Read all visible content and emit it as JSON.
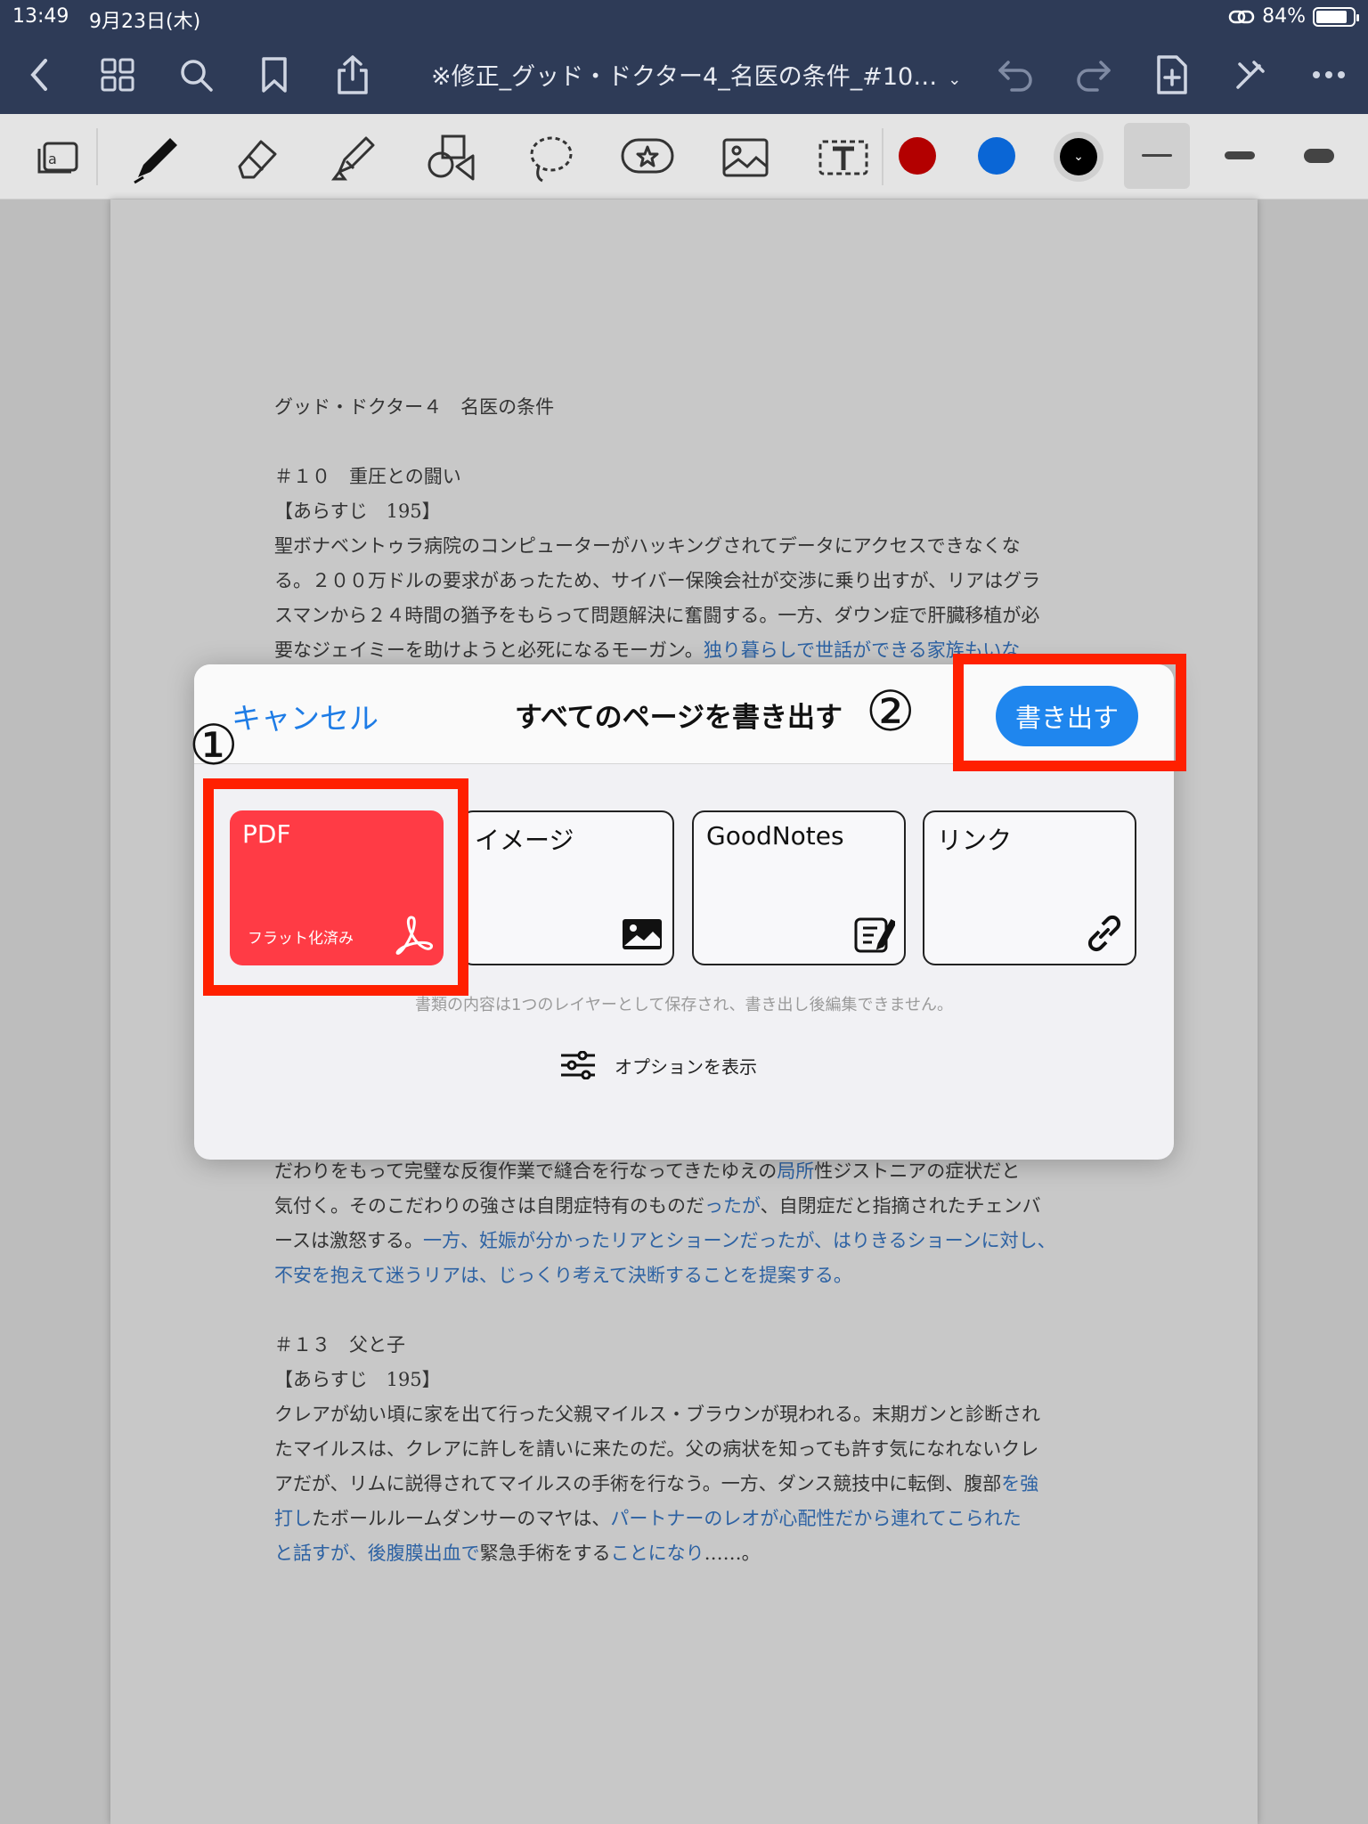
{
  "status": {
    "time": "13:49",
    "date": "9月23日(木)",
    "battery": "84%",
    "battery_level": 0.84
  },
  "nav": {
    "doc_title": "※修正_グッド・ドクター4_名医の条件_#10…",
    "buttons": [
      "back-icon",
      "thumbnails-icon",
      "search-icon",
      "bookmark-icon",
      "share-icon",
      "undo-icon",
      "redo-icon",
      "add-page-icon",
      "close-pen-icon",
      "more-icon"
    ]
  },
  "toolbar": {
    "tools": [
      "page-icon",
      "pen-icon",
      "eraser-icon",
      "highlighter-icon",
      "shapes-icon",
      "lasso-icon",
      "sticker-icon",
      "image-icon",
      "text-icon"
    ],
    "colors": [
      "#b30000",
      "#0a66d6",
      "#000000"
    ]
  },
  "document": {
    "line1": "グッド・ドクター４　名医の条件",
    "line2": "＃１０　重圧との闘い",
    "line3": "【あらすじ　195】",
    "p1": [
      "聖ボナベントゥラ病院のコンピューターがハッキングされてデータにアクセスできなくな",
      "る。２００万ドルの要求があったため、サイバー保険会社が交渉に乗り出すが、リアはグラ",
      "スマンから２４時間の猶予をもらって問題解決に奮闘する。一方、ダウン症で肝臓移植が必",
      "要なジェイミーを助けようと必死になるモーガン。"
    ],
    "p1_blue": "独り暮らしで世話ができる家族もいな",
    "p2a_1": "だわりをもって完璧な反復作業で縫合を行なってきたゆえの",
    "p2a_blue": "局所",
    "p2a_2": "性ジストニアの症状だと",
    "p2b_1": "気付く。そのこだわりの強さは自閉症特有のものだ",
    "p2b_blue": "ったが",
    "p2b_2": "、自閉症だと指摘されたチェンバ",
    "p2c_1": "ースは激怒する。",
    "p2c_blue": "一方、妊娠が分かったリアとショーンだったが、はりきるショーンに対し、",
    "p2d_blue": "不安を抱えて迷うリアは、じっくり考えて決断することを提案する。",
    "line4": "＃１３　父と子",
    "line5": "【あらすじ　195】",
    "p3a": "クレアが幼い頃に家を出て行った父親マイルス・ブラウンが現われる。末期ガンと診断され",
    "p3b": "たマイルスは、クレアに許しを請いに来たのだ。父の病状を知っても許す気になれないクレ",
    "p3c_1": "アだが、リムに説得されてマイルスの手術を行なう。一方、ダンス競技中に転倒、腹部",
    "p3c_blue": "を強",
    "p3d_blue1": "打し",
    "p3d_1": "たボールルームダンサーのマヤは、",
    "p3d_blue2": "パートナーのレオが心配性だから連れてこられた",
    "p3e_blue1": "と話すが、後腹膜出血で",
    "p3e_1": "緊急手術をする",
    "p3e_blue2": "ことになり",
    "p3e_2": "……。"
  },
  "modal": {
    "cancel": "キャンセル",
    "title": "すべてのページを書き出す",
    "export": "書き出す",
    "formats": [
      {
        "label": "PDF",
        "sub": "フラット化済み",
        "icon": "acrobat-icon"
      },
      {
        "label": "イメージ",
        "icon": "image-icon"
      },
      {
        "label": "GoodNotes",
        "icon": "notebook-icon"
      },
      {
        "label": "リンク",
        "icon": "link-icon"
      }
    ],
    "note": "書類の内容は1つのレイヤーとして保存され、書き出し後編集できません。",
    "options": "オプションを表示"
  },
  "annotations": {
    "step1": "①",
    "step2": "②"
  }
}
